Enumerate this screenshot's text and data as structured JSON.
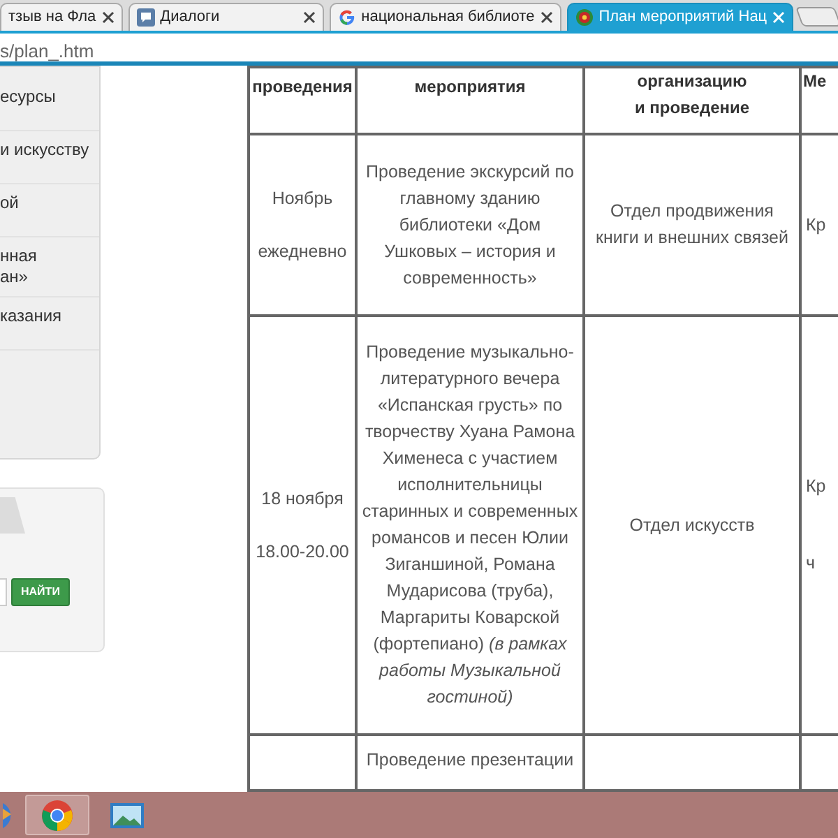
{
  "browser": {
    "tabs": [
      {
        "title": "тзыв на Фла",
        "selected": false
      },
      {
        "title": "Диалоги",
        "selected": false
      },
      {
        "title": "национальная библиоте",
        "selected": false
      },
      {
        "title": "План мероприятий Нац",
        "selected": true
      }
    ],
    "address": "s/plan_.htm"
  },
  "sidebar": {
    "menu_items": [
      {
        "lines": [
          "есурсы"
        ]
      },
      {
        "lines": [
          "и искусству"
        ]
      },
      {
        "lines": [
          "ой"
        ]
      },
      {
        "lines": [
          "нная",
          "ан»"
        ]
      },
      {
        "lines": [
          "казания"
        ]
      }
    ],
    "search_button": "НАЙТИ"
  },
  "table": {
    "columns": [
      {
        "lines": [
          "проведения"
        ]
      },
      {
        "lines": [
          "мероприятия"
        ]
      },
      {
        "lines": [
          "организацию",
          "и проведение"
        ]
      },
      {
        "lines": [
          "Ме"
        ]
      }
    ],
    "rows": [
      {
        "when": [
          "Ноябрь",
          "ежедневно"
        ],
        "event": "Проведение экскурсий по главному зданию библиотеки «Дом Ушковых – история и современность»",
        "organizer": "Отдел продвижения книги и внешних связей",
        "column_4": [
          "Кр"
        ]
      },
      {
        "when": [
          "18 ноября",
          "18.00-20.00"
        ],
        "event": "Проведение музыкально-литературного вечера «Испанская грусть» по творчеству Хуана Рамона Хименеса с участием исполнительницы старинных и современных романсов и песен Юлии Зиганшиной, Романа Мударисова (труба), Маргариты Коварской (фортепиано) *(в рамках работы Музыкальной гостиной)*",
        "organizer": "Отдел искусств",
        "column_4": [
          "Кр",
          "ч"
        ]
      },
      {
        "event": "Проведение презентации"
      }
    ]
  },
  "taskbar": {
    "apps": [
      {
        "kind": "start",
        "active": false
      },
      {
        "kind": "chrome",
        "active": true
      },
      {
        "kind": "photos",
        "active": false
      }
    ]
  }
}
